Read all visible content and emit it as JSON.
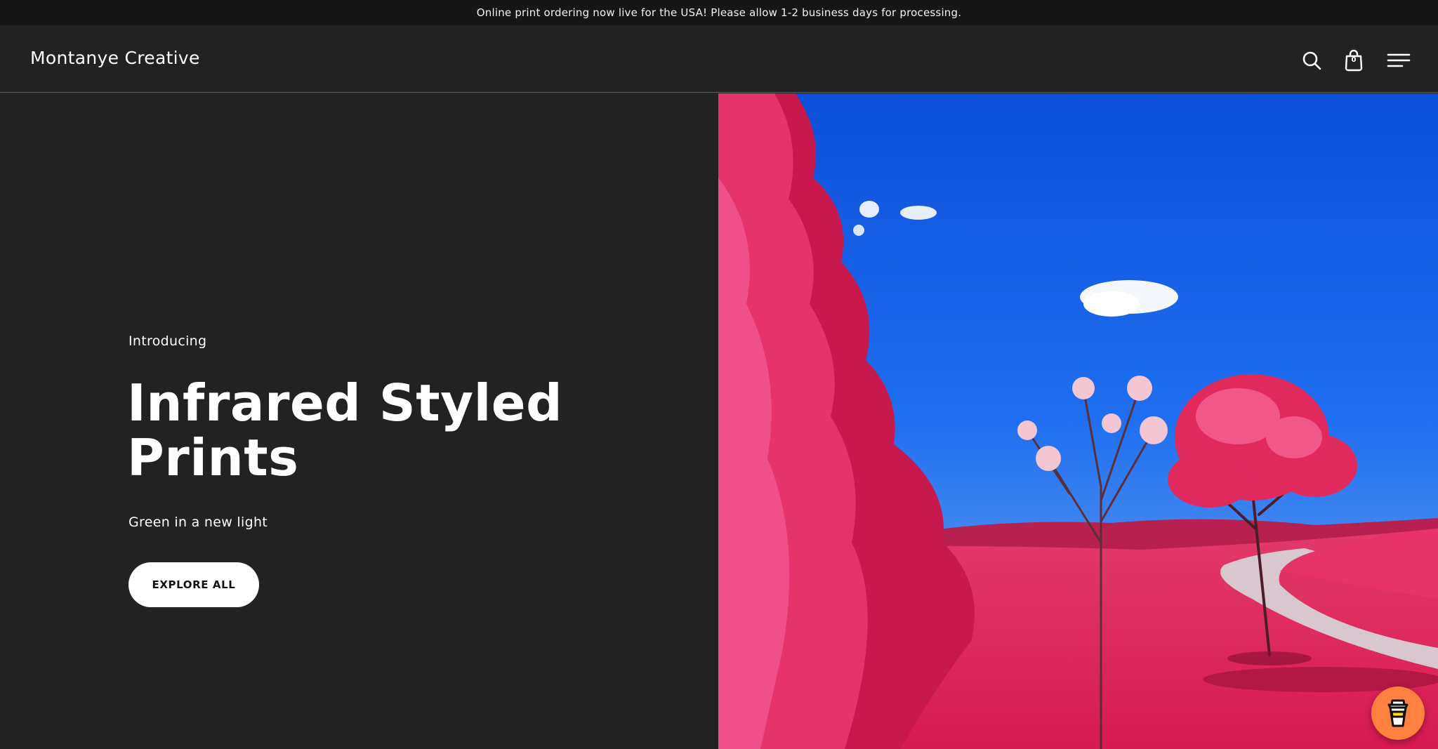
{
  "announcement": {
    "text": "Online print ordering now live for the USA! Please allow 1-2 business days for processing."
  },
  "header": {
    "logo": "Montanye Creative",
    "icons": {
      "search": "search-icon",
      "cart": "shopping-bag-icon",
      "menu": "hamburger-menu-icon"
    },
    "cart_count": "0"
  },
  "hero": {
    "eyebrow": "Introducing",
    "title": "Infrared Styled Prints",
    "subtitle": "Green in a new light",
    "cta_label": "EXPLORE ALL",
    "image_description": "infrared landscape photo"
  },
  "floating": {
    "icon": "coffee-cup-icon"
  },
  "colors": {
    "background": "#222222",
    "announcement_bg": "#161616",
    "cta_bg": "#ffffff",
    "coffee_button": "#ff813f"
  }
}
